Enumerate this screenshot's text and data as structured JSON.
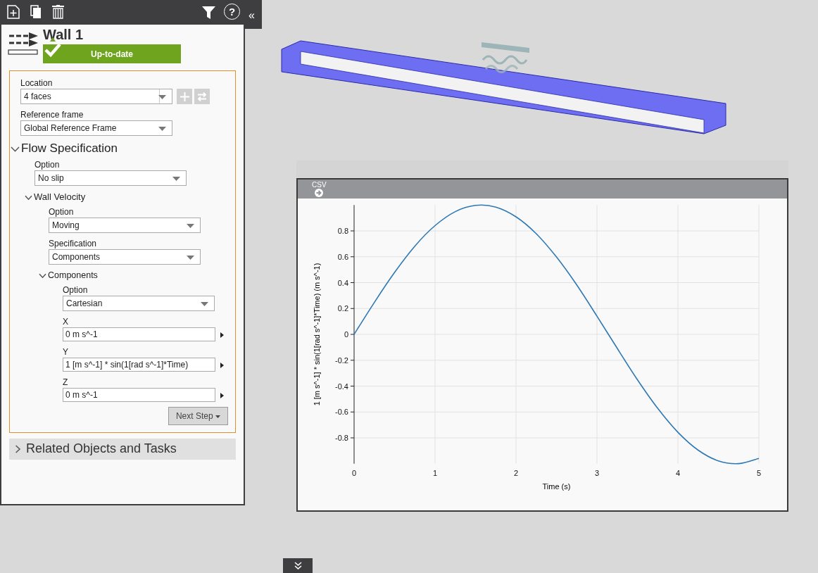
{
  "toolbar": {
    "help_glyph": "?",
    "collapse_glyph": "«"
  },
  "header": {
    "title": "Wall 1",
    "status": "Up-to-date"
  },
  "form": {
    "items": [
      {
        "kind": "select_actions",
        "label": "Location",
        "value": "4 faces"
      },
      {
        "kind": "select",
        "label": "Reference frame",
        "value": "Global Reference Frame"
      },
      {
        "kind": "group",
        "label": "Flow Specification",
        "expanded": true,
        "children": [
          {
            "kind": "select",
            "label": "Option",
            "value": "No slip"
          },
          {
            "kind": "group",
            "label": "Wall Velocity",
            "expanded": true,
            "children": [
              {
                "kind": "select",
                "label": "Option",
                "value": "Moving"
              },
              {
                "kind": "select",
                "label": "Specification",
                "value": "Components"
              },
              {
                "kind": "group",
                "label": "Components",
                "expanded": true,
                "children": [
                  {
                    "kind": "select",
                    "label": "Option",
                    "value": "Cartesian"
                  },
                  {
                    "kind": "expression",
                    "label": "X",
                    "value": "0 m s^-1"
                  },
                  {
                    "kind": "expression",
                    "label": "Y",
                    "value": "1 [m s^-1] * sin(1[rad s^-1]*Time)"
                  },
                  {
                    "kind": "expression",
                    "label": "Z",
                    "value": "0 m s^-1"
                  }
                ]
              }
            ]
          }
        ]
      }
    ],
    "next_button": "Next Step"
  },
  "related": {
    "label": "Related Objects and Tasks",
    "expanded": false
  },
  "chart_panel": {
    "export_label": "CSV",
    "chart_data": {
      "type": "line",
      "xlabel": "Time (s)",
      "ylabel": "1 [m s^-1] * sin(1[rad s^-1]*Time) (m s^-1)",
      "x": [
        0,
        0.25,
        0.5,
        0.75,
        1,
        1.25,
        1.5,
        1.75,
        2,
        2.25,
        2.5,
        2.75,
        3,
        3.25,
        3.5,
        3.75,
        4,
        4.25,
        4.5,
        4.75,
        5
      ],
      "series": [
        {
          "color": "#2e78b4",
          "values": [
            0,
            0.247,
            0.479,
            0.682,
            0.841,
            0.949,
            0.997,
            0.984,
            0.909,
            0.778,
            0.598,
            0.382,
            0.141,
            -0.108,
            -0.351,
            -0.572,
            -0.757,
            -0.895,
            -0.978,
            -0.999,
            -0.959
          ]
        }
      ],
      "grid": true,
      "xlim": [
        0,
        5
      ],
      "ylim": [
        -1,
        1
      ],
      "xticks": [
        0,
        1,
        2,
        3,
        4,
        5
      ],
      "yticks": [
        -0.8,
        -0.6,
        -0.4,
        -0.2,
        0,
        0.2,
        0.4,
        0.6,
        0.8
      ]
    }
  }
}
